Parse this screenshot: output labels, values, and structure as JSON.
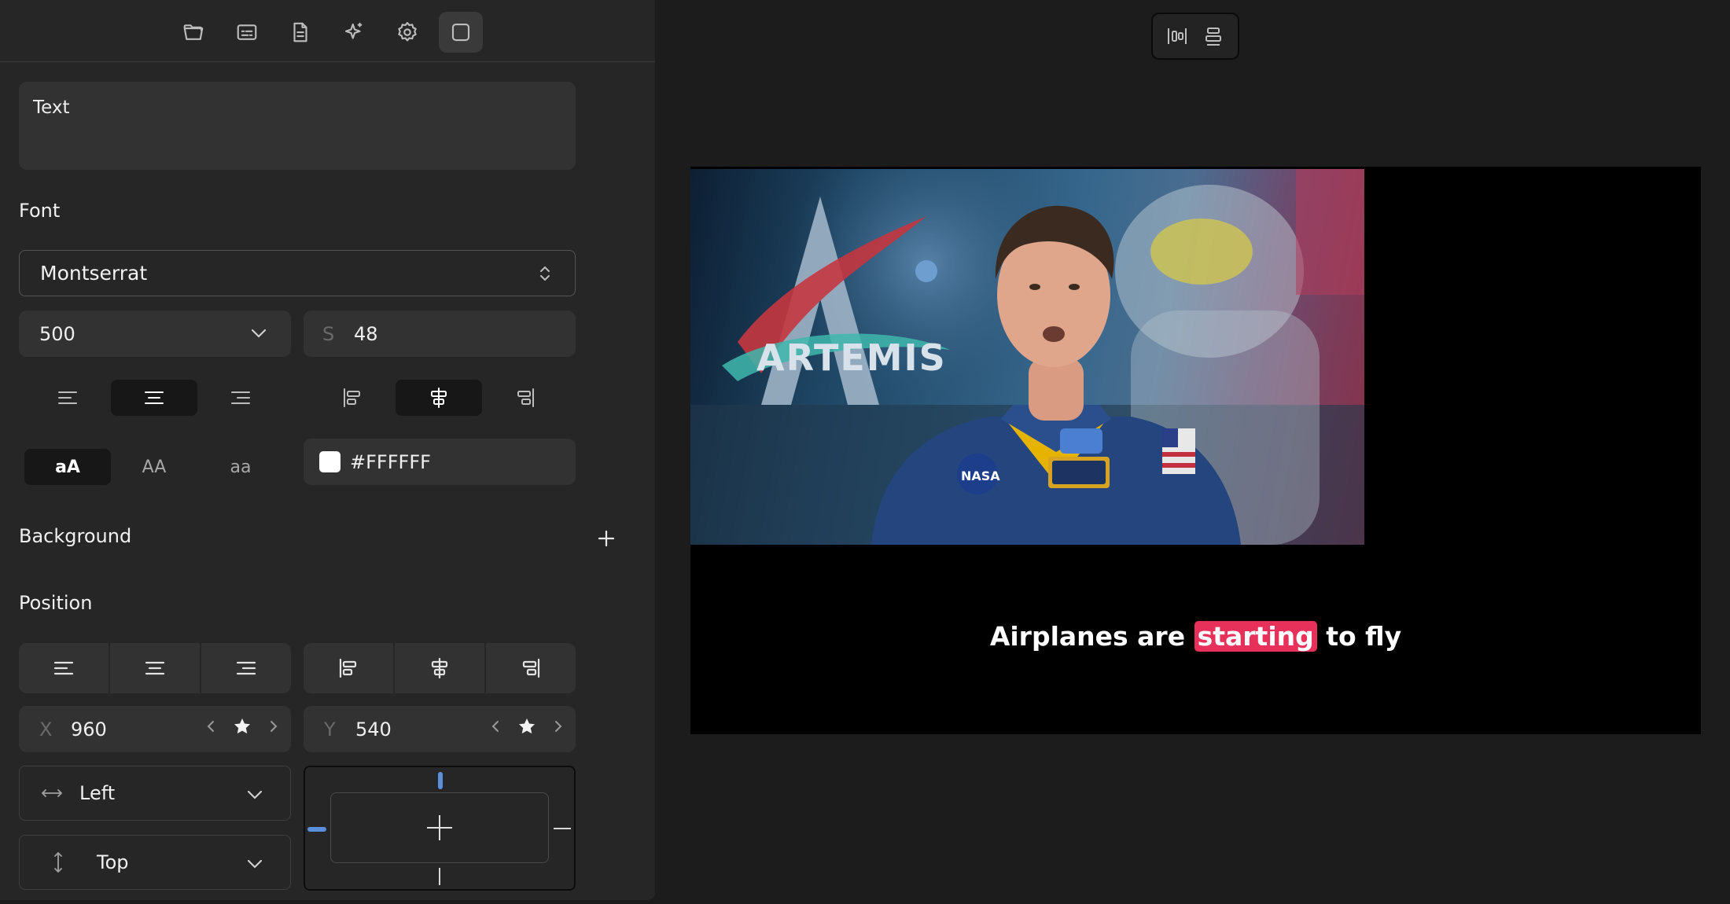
{
  "toolbar": {
    "items": [
      {
        "name": "folder-open-icon",
        "active": false
      },
      {
        "name": "subtitles-icon",
        "active": false
      },
      {
        "name": "document-icon",
        "active": false
      },
      {
        "name": "sparkles-icon",
        "active": false
      },
      {
        "name": "gear-icon",
        "active": false
      },
      {
        "name": "frame-icon",
        "active": true
      }
    ]
  },
  "text_field": {
    "value": "Text"
  },
  "font": {
    "section_label": "Font",
    "family": "Montserrat",
    "weight": "500",
    "size_label": "S",
    "size": "48",
    "text_align_selected": "center",
    "vertical_align_selected": "middle",
    "case_options": [
      "aA",
      "AA",
      "aa"
    ],
    "case_selected": "aA",
    "color": "#FFFFFF"
  },
  "background": {
    "section_label": "Background"
  },
  "position": {
    "section_label": "Position",
    "x_label": "X",
    "x": "960",
    "y_label": "Y",
    "y": "540",
    "horizontal_anchor": "Left",
    "vertical_anchor": "Top"
  },
  "preview": {
    "caption_before": "Airplanes are ",
    "caption_highlight": "starting",
    "caption_after": " to fly",
    "highlight_color": "#e8315a",
    "video_logo_text": "ARTEMIS",
    "badge_text": "NASA"
  }
}
